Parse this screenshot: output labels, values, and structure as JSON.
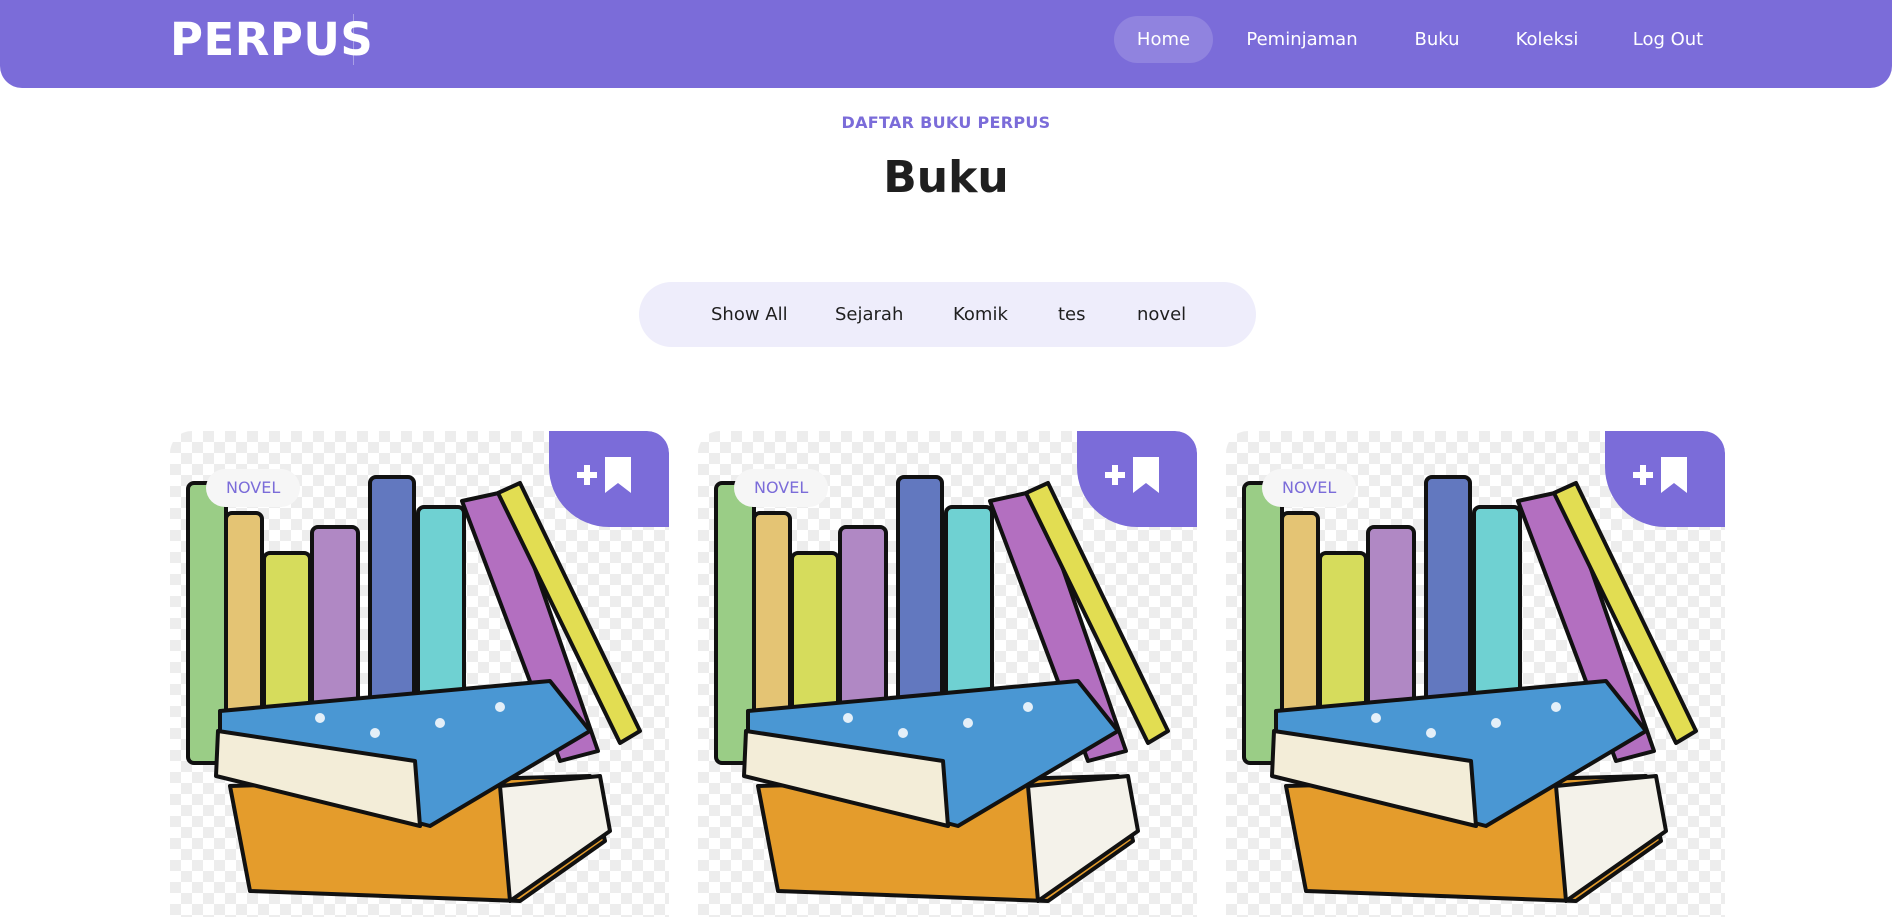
{
  "header": {
    "logo": "PERPUS",
    "nav": [
      {
        "label": "Home",
        "active": true
      },
      {
        "label": "Peminjaman",
        "active": false
      },
      {
        "label": "Buku",
        "active": false
      },
      {
        "label": "Koleksi",
        "active": false
      },
      {
        "label": "Log Out",
        "active": false
      }
    ]
  },
  "section": {
    "subtitle": "DAFTAR BUKU PERPUS",
    "title": "Buku"
  },
  "filters": [
    {
      "label": "Show All"
    },
    {
      "label": "Sejarah"
    },
    {
      "label": "Komik"
    },
    {
      "label": "tes"
    },
    {
      "label": "novel"
    }
  ],
  "cards": [
    {
      "category": "NOVEL",
      "icon": "bookmark-add-icon"
    },
    {
      "category": "NOVEL",
      "icon": "bookmark-add-icon"
    },
    {
      "category": "NOVEL",
      "icon": "bookmark-add-icon"
    }
  ],
  "colors": {
    "accent": "#7b6cd9",
    "filter_bg": "#eeedfb",
    "text": "#1f1f1f"
  }
}
